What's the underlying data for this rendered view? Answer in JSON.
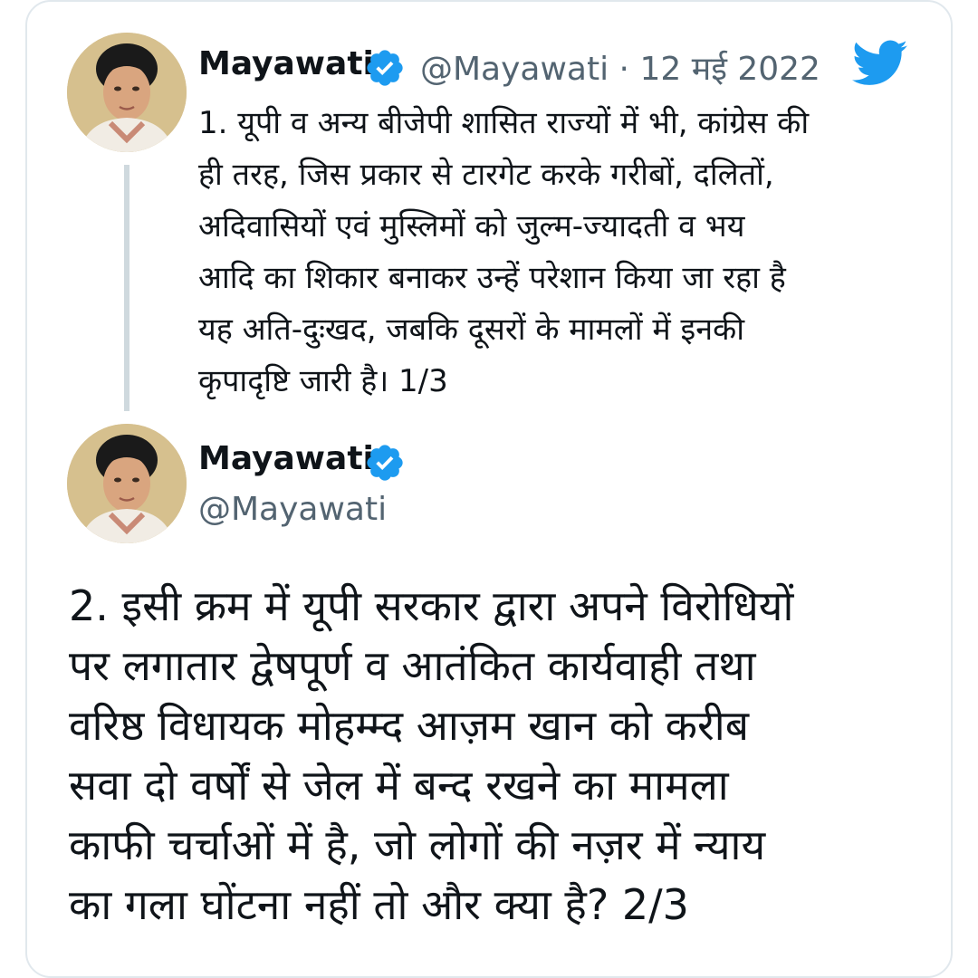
{
  "colors": {
    "verified_blue": "#1d9bf0",
    "twitter_blue": "#1d9bf0",
    "handle_gray": "#536471",
    "text": "#0f1419",
    "thread_line": "#cfd9de"
  },
  "icons": {
    "verified": "verified-badge-icon",
    "brand": "twitter-bird-icon"
  },
  "tweet1": {
    "author_name": "Mayawati",
    "handle_and_date": "@Mayawati · 12 मई 2022",
    "text": "1. यूपी व अन्य बीजेपी शासित राज्यों में भी, कांग्रेस की\nही तरह, जिस प्रकार से टारगेट करके गरीबों, दलितों,\nअदिवासियों एवं मुस्लिमों को जुल्म-ज्यादती व भय\nआदि का शिकार बनाकर उन्हें परेशान किया जा रहा है\nयह अति-दुःखद, जबकि दूसरों के मामलों में इनकी\nकृपादृष्टि जारी है। 1/3"
  },
  "tweet2": {
    "author_name": "Mayawati",
    "handle": "@Mayawati",
    "text": "2. इसी क्रम में यूपी सरकार द्वारा अपने विरोधियों\nपर लगातार द्वेषपूर्ण व आतंकित कार्यवाही तथा\nवरिष्ठ विधायक मोहम्म्द आज़म खान को करीब\nसवा दो वर्षों से जेल में बन्द रखने का मामला\nकाफी चर्चाओं में है, जो लोगों की नज़र में न्याय\nका गला घोंटना नहीं तो और क्या है? 2/3"
  }
}
